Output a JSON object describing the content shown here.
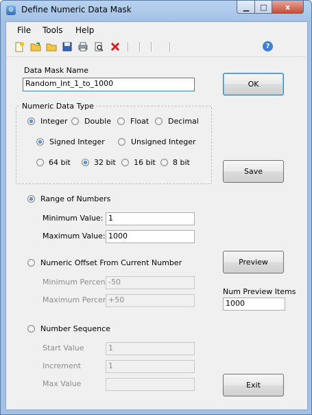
{
  "window": {
    "title": "Define Numeric Data Mask",
    "minimize": "▁",
    "maximize": "□",
    "close": "x"
  },
  "menu": {
    "file": "File",
    "tools": "Tools",
    "help": "Help"
  },
  "toolbar": {
    "help_glyph": "?"
  },
  "mask_name": {
    "label": "Data Mask Name",
    "value": "Random_Int_1_to_1000"
  },
  "numeric_type": {
    "title": "Numeric Data Type",
    "types": {
      "integer": "Integer",
      "double": "Double",
      "float": "Float",
      "decimal": "Decimal"
    },
    "selected_type": "Integer",
    "sign": {
      "signed": "Signed Integer",
      "unsigned": "Unsigned Integer"
    },
    "selected_sign": "Signed Integer",
    "bits": {
      "b64": "64 bit",
      "b32": "32 bit",
      "b16": "16 bit",
      "b8": "8 bit"
    },
    "selected_bits": "32 bit"
  },
  "range": {
    "label": "Range of Numbers",
    "min_label": "Minimum Value:",
    "min_value": "1",
    "max_label": "Maximum Value:",
    "max_value": "1000"
  },
  "offset": {
    "label": "Numeric Offset From Current Number",
    "min_label": "Minimum Percent",
    "min_value": "-50",
    "max_label": "Maximum Percent",
    "max_value": "+50"
  },
  "sequence": {
    "label": "Number Sequence",
    "start_label": "Start Value",
    "start_value": "1",
    "increment_label": "Increment",
    "increment_value": "1",
    "max_label": "Max Value",
    "max_value": ""
  },
  "buttons": {
    "ok": "OK",
    "save": "Save",
    "preview": "Preview",
    "exit": "Exit"
  },
  "preview": {
    "label": "Num Preview Items",
    "value": "1000"
  }
}
